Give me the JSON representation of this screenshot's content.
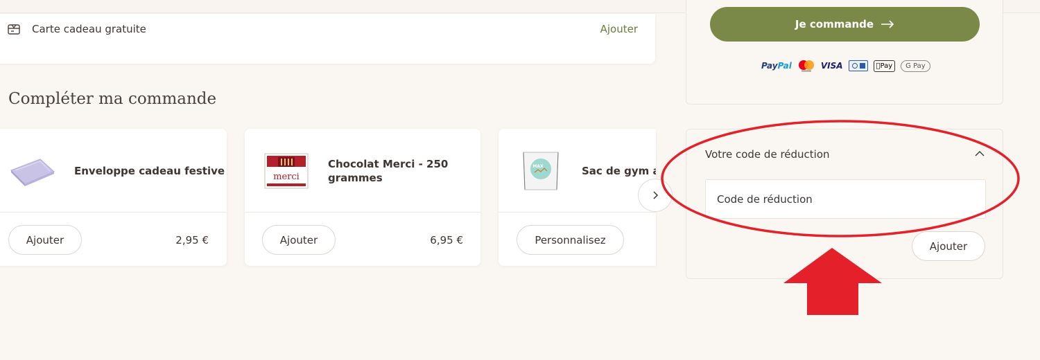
{
  "gift_card": {
    "label": "Carte cadeau gratuite",
    "add_label": "Ajouter"
  },
  "section_title": "Compléter ma commande",
  "products": [
    {
      "name": "Enveloppe cadeau festive",
      "button": "Ajouter",
      "price": "2,95 €"
    },
    {
      "name_line1": "Chocolat Merci - 250",
      "name_line2": "grammes",
      "button": "Ajouter",
      "price": "6,95 €"
    },
    {
      "name": "Sac de gym av",
      "button": "Personnalisez"
    }
  ],
  "checkout": {
    "cta_label": "Je commande",
    "payments": [
      "PayPal",
      "Mastercard",
      "VISA",
      "CB",
      "Apple Pay",
      "G Pay"
    ]
  },
  "discount": {
    "title": "Votre code de réduction",
    "placeholder": "Code de réduction",
    "add_label": "Ajouter"
  },
  "colors": {
    "background": "#faf6f1",
    "accent_green": "#7a8947",
    "annotation_red": "#e4202a"
  },
  "icons": [
    "gift-card-icon",
    "chevron-right-icon",
    "arrow-right-icon",
    "chevron-up-icon"
  ]
}
